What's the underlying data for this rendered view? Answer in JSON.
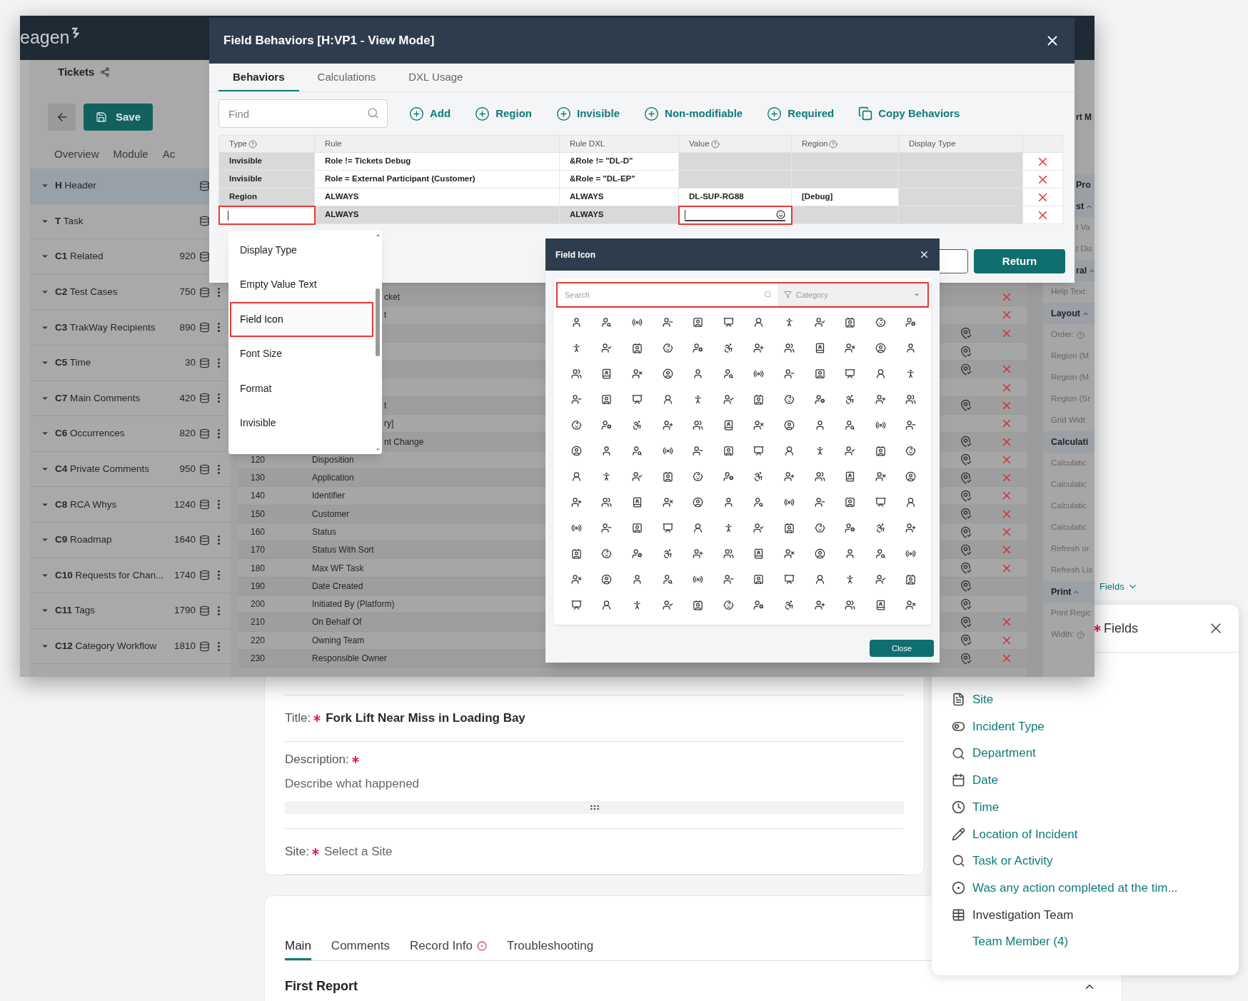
{
  "app": {
    "logo": "eagen",
    "breadcrumb": "Tickets",
    "save_label": "Save",
    "tabs": [
      {
        "label": "Overview",
        "selected": false
      },
      {
        "label": "Module",
        "selected": false
      },
      {
        "label": "Ac",
        "selected": false
      }
    ],
    "sections": [
      {
        "code": "H",
        "name": "Header",
        "selected": true,
        "menu": false
      },
      {
        "code": "T",
        "name": "Task",
        "selected": false,
        "menu": false
      },
      {
        "code": "C1",
        "name": "Related",
        "count": "920",
        "selected": false,
        "menu": false
      },
      {
        "code": "C2",
        "name": "Test Cases",
        "count": "750",
        "selected": false,
        "menu": true
      },
      {
        "code": "C3",
        "name": "TrakWay Recipients",
        "count": "890",
        "selected": false,
        "menu": true
      },
      {
        "code": "C5",
        "name": "Time",
        "count": "30",
        "selected": false,
        "menu": true
      },
      {
        "code": "C7",
        "name": "Main Comments",
        "count": "420",
        "selected": false,
        "menu": true
      },
      {
        "code": "C6",
        "name": "Occurrences",
        "count": "820",
        "selected": false,
        "menu": true
      },
      {
        "code": "C4",
        "name": "Private Comments",
        "count": "950",
        "selected": false,
        "menu": true
      },
      {
        "code": "C8",
        "name": "RCA Whys",
        "count": "1240",
        "selected": false,
        "menu": true
      },
      {
        "code": "C9",
        "name": "Roadmap",
        "count": "1640",
        "selected": false,
        "menu": true
      },
      {
        "code": "C10",
        "name": "Requests for Chan...",
        "count": "1740",
        "selected": false,
        "menu": true
      },
      {
        "code": "C11",
        "name": "Tags",
        "count": "1790",
        "selected": false,
        "menu": true
      },
      {
        "code": "C12",
        "name": "Category Workflow",
        "count": "1810",
        "selected": false,
        "menu": true
      }
    ]
  },
  "background_table": {
    "rows": [
      {
        "kind": "partial",
        "name": "cket",
        "flag": false,
        "removable": true
      },
      {
        "kind": "partial",
        "name": "t",
        "flag": false,
        "removable": true
      },
      {
        "kind": "empty",
        "flag": true,
        "removable": true
      },
      {
        "kind": "empty",
        "flag": true,
        "removable": false
      },
      {
        "kind": "empty",
        "flag": true,
        "removable": true
      },
      {
        "kind": "empty",
        "flag": false,
        "removable": true
      },
      {
        "kind": "partial",
        "name": "t",
        "flag": true,
        "removable": true
      },
      {
        "kind": "partial",
        "name": "ry]",
        "flag": false,
        "removable": true
      },
      {
        "kind": "partial",
        "name": "nt Change",
        "flag": true,
        "removable": true
      },
      {
        "kind": "full",
        "number": "120",
        "name": "Disposition",
        "flag": true,
        "removable": true
      },
      {
        "kind": "full",
        "number": "130",
        "name": "Application",
        "flag": true,
        "removable": true
      },
      {
        "kind": "full",
        "number": "140",
        "name": "Identifier",
        "flag": true,
        "removable": true
      },
      {
        "kind": "full",
        "number": "150",
        "name": "Customer",
        "flag": true,
        "removable": true
      },
      {
        "kind": "full",
        "number": "160",
        "name": "Status",
        "flag": true,
        "removable": true
      },
      {
        "kind": "full",
        "number": "170",
        "name": "Status With Sort",
        "flag": true,
        "removable": true
      },
      {
        "kind": "full",
        "number": "180",
        "name": "Max WF Task",
        "flag": true,
        "removable": true
      },
      {
        "kind": "full",
        "number": "190",
        "name": "Date Created",
        "flag": true,
        "removable": false
      },
      {
        "kind": "full",
        "number": "200",
        "name": "Initiated By (Platform)",
        "flag": true,
        "removable": false
      },
      {
        "kind": "full",
        "number": "210",
        "name": "On Behalf Of",
        "flag": true,
        "removable": true
      },
      {
        "kind": "full",
        "number": "220",
        "name": "Owning Team",
        "flag": true,
        "removable": true
      },
      {
        "kind": "full",
        "number": "230",
        "name": "Responsible Owner",
        "flag": true,
        "removable": true
      }
    ]
  },
  "properties_panel": {
    "title": "rt M",
    "items": [
      {
        "kind": "section",
        "label": "Pro",
        "clipped": true
      },
      {
        "kind": "section",
        "label": "st",
        "expanded": true,
        "clipped": true
      },
      {
        "kind": "item",
        "label": "t Va",
        "clipped": true
      },
      {
        "kind": "item",
        "label": "t Dis",
        "clipped": true
      },
      {
        "kind": "section",
        "label": "ral",
        "expanded": true,
        "clipped": true
      },
      {
        "kind": "item",
        "label": "Help Text:",
        "clipped": false
      },
      {
        "kind": "section",
        "label": "Layout",
        "expanded": true,
        "clipped": false
      },
      {
        "kind": "item",
        "label": "Order:",
        "help": true,
        "clipped": false
      },
      {
        "kind": "item",
        "label": "Region (M",
        "clipped": false
      },
      {
        "kind": "item",
        "label": "Region (M",
        "clipped": false
      },
      {
        "kind": "item",
        "label": "Region (Sr",
        "clipped": false
      },
      {
        "kind": "item",
        "label": "Grid Widt",
        "clipped": false
      },
      {
        "kind": "section",
        "label": "Calculati",
        "clipped": false
      },
      {
        "kind": "item",
        "label": "Calculatic",
        "clipped": false
      },
      {
        "kind": "item",
        "label": "Calculatic",
        "clipped": false
      },
      {
        "kind": "item",
        "label": "Calculatic",
        "clipped": false
      },
      {
        "kind": "item",
        "label": "Calculatic",
        "clipped": false
      },
      {
        "kind": "item",
        "label": "Refresh or",
        "clipped": false
      },
      {
        "kind": "item",
        "label": "Refresh Lis",
        "clipped": false
      },
      {
        "kind": "section",
        "label": "Print",
        "expanded": true,
        "clipped": false
      },
      {
        "kind": "item",
        "label": "Print Regic",
        "clipped": false
      },
      {
        "kind": "item",
        "label": "Width:",
        "help": true,
        "clipped": false
      }
    ]
  },
  "behaviors_dialog": {
    "title": "Field Behaviors [H:VP1 - View Mode]",
    "tabs": [
      {
        "label": "Behaviors",
        "selected": true
      },
      {
        "label": "Calculations",
        "selected": false
      },
      {
        "label": "DXL Usage",
        "selected": false
      }
    ],
    "find_placeholder": "Find",
    "actions": [
      {
        "kind": "add",
        "label": "Add"
      },
      {
        "kind": "add",
        "label": "Region"
      },
      {
        "kind": "add",
        "label": "Invisible"
      },
      {
        "kind": "add",
        "label": "Non-modifiable"
      },
      {
        "kind": "add",
        "label": "Required"
      },
      {
        "kind": "copy",
        "label": "Copy Behaviors"
      }
    ],
    "columns": [
      {
        "label": "Type",
        "help": true
      },
      {
        "label": "Rule",
        "help": false
      },
      {
        "label": "Rule DXL",
        "help": false
      },
      {
        "label": "Value",
        "help": true
      },
      {
        "label": "Region",
        "help": true
      },
      {
        "label": "Display Type",
        "help": false
      }
    ],
    "rows": [
      {
        "type": "Invisible",
        "rule": "Role != Tickets Debug",
        "rule_dxl": "&Role != \"DL-D\"",
        "editing": false
      },
      {
        "type": "Invisible",
        "rule": "Role = External Participant (Customer)",
        "rule_dxl": "&Role = \"DL-EP\"",
        "editing": false
      },
      {
        "type": "Region",
        "rule": "ALWAYS",
        "rule_dxl": "ALWAYS",
        "value": "DL-SUP-RG88",
        "region": "[Debug]",
        "editing": false
      },
      {
        "rule": "ALWAYS",
        "rule_dxl": "ALWAYS",
        "editing": true
      }
    ],
    "return_label": "Return"
  },
  "type_menu": {
    "items": [
      {
        "label": "Display Type",
        "selected": false
      },
      {
        "label": "Empty Value Text",
        "selected": false
      },
      {
        "label": "Field Icon",
        "selected": true
      },
      {
        "label": "Font Size",
        "selected": false
      },
      {
        "label": "Format",
        "selected": false
      },
      {
        "label": "Invisible",
        "selected": false
      }
    ]
  },
  "icon_dialog": {
    "title": "Field Icon",
    "search_placeholder": "Search",
    "category_placeholder": "Category",
    "close_label": "Close"
  },
  "fields_link": {
    "label": "Fields"
  },
  "form": {
    "fields": [
      {
        "kind": "text",
        "label": "Title:",
        "required": true,
        "value": "Fork Lift Near Miss in Loading Bay"
      },
      {
        "kind": "textarea",
        "label": "Description:",
        "required": true,
        "placeholder": "Describe what happened"
      },
      {
        "kind": "select",
        "label": "Site:",
        "required": true,
        "placeholder": "Select a Site"
      }
    ]
  },
  "record_tabs": [
    {
      "label": "Main",
      "selected": true,
      "badge": false
    },
    {
      "label": "Comments",
      "selected": false,
      "badge": false
    },
    {
      "label": "Record Info",
      "selected": false,
      "badge": true
    },
    {
      "label": "Troubleshooting",
      "selected": false,
      "badge": false
    }
  ],
  "section": {
    "title": "First Report",
    "expanded": true
  },
  "fields_panel": {
    "title": "Fields",
    "required": true,
    "items": [
      {
        "kind": "text",
        "label": "Site"
      },
      {
        "kind": "toggle",
        "label": "Incident Type"
      },
      {
        "kind": "search",
        "label": "Department"
      },
      {
        "kind": "date",
        "label": "Date"
      },
      {
        "kind": "time",
        "label": "Time"
      },
      {
        "kind": "pen",
        "label": "Location of Incident"
      },
      {
        "kind": "search",
        "label": "Task or Activity"
      },
      {
        "kind": "radio",
        "label": "Was any action completed at the tim..."
      },
      {
        "kind": "table",
        "label": "Investigation Team",
        "children": [
          {
            "label": "Team Member (4)"
          }
        ]
      }
    ]
  }
}
